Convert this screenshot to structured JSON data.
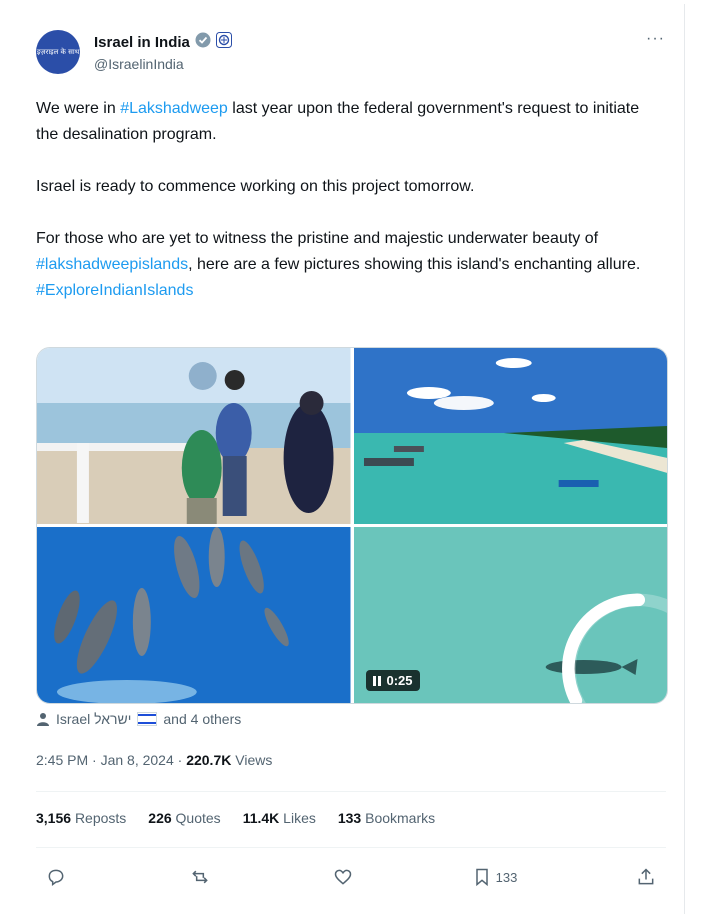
{
  "account": {
    "display_name": "Israel in India",
    "handle": "@IsraelinIndia",
    "avatar_text": "इज़राइल के साथ",
    "more_label": "···"
  },
  "tweet": {
    "p1_pre": "We were in ",
    "p1_tag": "#Lakshadweep",
    "p1_post": " last year upon the federal government's request to initiate the desalination program.",
    "p2": "Israel is ready to commence working on this project tomorrow.",
    "p3_pre": "For those who are yet to witness the pristine and majestic underwater beauty of ",
    "p3_tag": "#lakshadweepislands",
    "p3_post": ", here are a few pictures showing this island's enchanting allure.",
    "p4_tag": "#ExploreIndianIslands"
  },
  "media": {
    "video_duration": "0:25"
  },
  "tagged": {
    "name": "Israel ישראל",
    "others": "and 4 others"
  },
  "meta": {
    "time": "2:45 PM · Jan 8, 2024 · ",
    "views_count": "220.7K",
    "views_label": " Views"
  },
  "stats": {
    "reposts_count": "3,156",
    "reposts_label": "Reposts",
    "quotes_count": "226",
    "quotes_label": "Quotes",
    "likes_count": "11.4K",
    "likes_label": "Likes",
    "bookmarks_count": "133",
    "bookmarks_label": "Bookmarks"
  },
  "actions": {
    "bookmark_count": "133"
  },
  "colors": {
    "hashtag": "#1d9bf0",
    "verified_badge": "#829aab",
    "avatar_bg": "#2b4ea8"
  }
}
